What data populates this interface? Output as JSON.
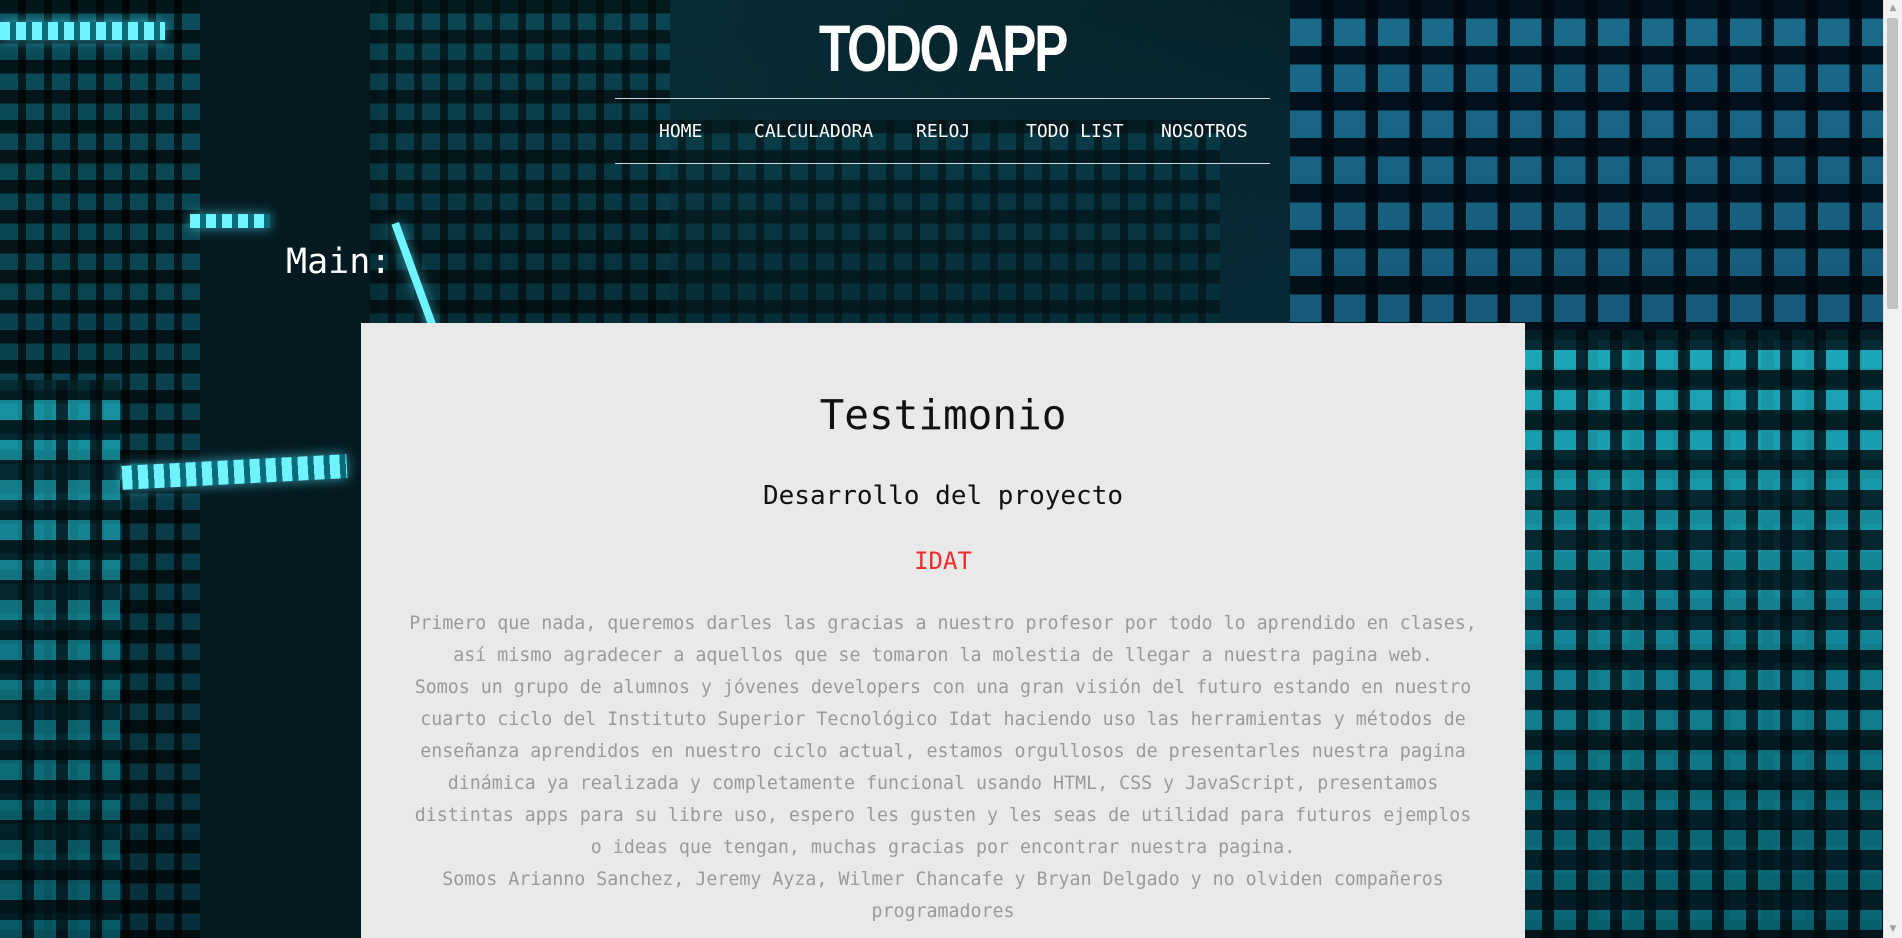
{
  "header": {
    "title": "TODO APP"
  },
  "nav": {
    "items": [
      {
        "label": "HOME"
      },
      {
        "label": "CALCULADORA"
      },
      {
        "label": "RELOJ"
      },
      {
        "label": "TODO LIST"
      },
      {
        "label": "NOSOTROS"
      }
    ]
  },
  "main": {
    "label": "Main:",
    "card": {
      "title": "Testimonio",
      "subtitle": "Desarrollo del proyecto",
      "org": "IDAT",
      "org_color": "#f22b2b",
      "paragraphs": [
        "Primero que nada, queremos darles las gracias a nuestro profesor por todo lo aprendido en clases, así mismo agradecer a aquellos que se tomaron la molestia de llegar a nuestra pagina web.",
        "Somos un grupo de alumnos y jóvenes developers con una gran visión del futuro estando en nuestro cuarto ciclo del Instituto Superior Tecnológico Idat haciendo uso las herramientas y métodos de enseñanza aprendidos en nuestro ciclo actual, estamos orgullosos de presentarles nuestra pagina dinámica ya realizada y completamente funcional usando HTML, CSS y JavaScript, presentamos distintas apps para su libre uso, espero les gusten y les seas de utilidad para futuros ejemplos o ideas que tengan, muchas gracias por encontrar nuestra pagina.",
        "Somos Arianno Sanchez, Jeremy Ayza, Wilmer Chancafe y Bryan Delgado y no olviden compañeros programadores"
      ]
    }
  },
  "colors": {
    "card_background": "#e9e9e9",
    "body_text": "#9a9a9a",
    "accent_teal": "#1fb8c8"
  }
}
